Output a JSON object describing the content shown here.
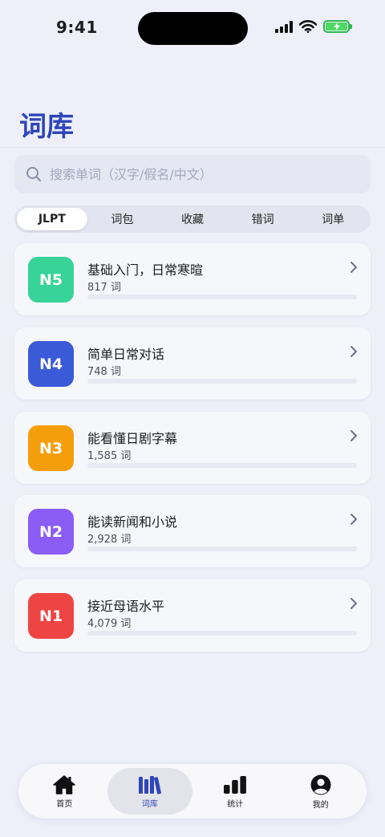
{
  "status_bar": {
    "time": "9:41"
  },
  "page": {
    "title": "词库"
  },
  "search": {
    "placeholder": "搜索单词（汉字/假名/中文）",
    "icon": "search-icon"
  },
  "segments": [
    {
      "label": "JLPT",
      "active": true
    },
    {
      "label": "词包",
      "active": false
    },
    {
      "label": "收藏",
      "active": false
    },
    {
      "label": "错词",
      "active": false
    },
    {
      "label": "词单",
      "active": false
    }
  ],
  "levels": [
    {
      "badge": "N5",
      "title": "基础入门，日常寒暄",
      "count": "817 词",
      "progress": 0,
      "color": "#37d399"
    },
    {
      "badge": "N4",
      "title": "简单日常对话",
      "count": "748 词",
      "progress": 0,
      "color": "#3b5ad8"
    },
    {
      "badge": "N3",
      "title": "能看懂日剧字幕",
      "count": "1,585 词",
      "progress": 0,
      "color": "#f59e0b"
    },
    {
      "badge": "N2",
      "title": "能读新闻和小说",
      "count": "2,928 词",
      "progress": 0,
      "color": "#8b5cf6"
    },
    {
      "badge": "N1",
      "title": "接近母语水平",
      "count": "4,079 词",
      "progress": 0,
      "color": "#ef4444"
    }
  ],
  "tab_bar": [
    {
      "label": "首页",
      "icon": "home-icon",
      "active": false
    },
    {
      "label": "词库",
      "icon": "library-icon",
      "active": true
    },
    {
      "label": "统计",
      "icon": "stats-icon",
      "active": false
    },
    {
      "label": "我的",
      "icon": "profile-icon",
      "active": false
    }
  ],
  "colors": {
    "accent": "#2e46b8",
    "background": "#eeeff8",
    "battery": "#4cd964"
  }
}
